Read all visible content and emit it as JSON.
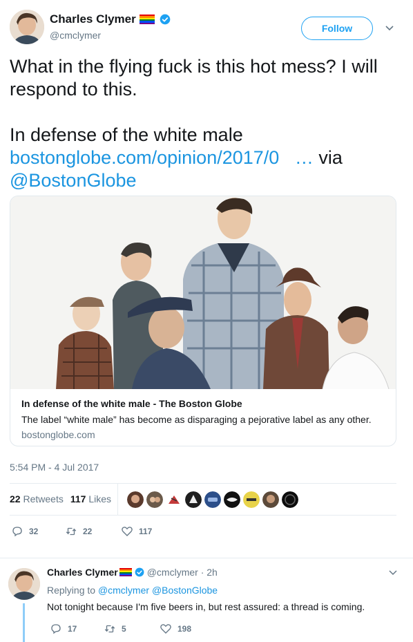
{
  "tweet": {
    "author_name": "Charles Clymer",
    "author_handle": "@cmclymer",
    "follow_label": "Follow",
    "text_line1": "What in the flying fuck is this hot mess? I will respond to this.",
    "text_line2": "In defense of the white male",
    "link_text": "bostonglobe.com/opinion/2017/0",
    "ellipsis": "…",
    "via_text": " via",
    "mention": "@BostonGlobe",
    "timestamp": "5:54 PM - 4 Jul 2017"
  },
  "card": {
    "title": "In defense of the white male - The Boston Globe",
    "description": "The label “white male” has become as disparaging a pejorative label as any other.",
    "domain": "bostonglobe.com"
  },
  "stats": {
    "retweets_count": "22",
    "retweets_label": "Retweets",
    "likes_count": "117",
    "likes_label": "Likes"
  },
  "actions": {
    "replies": "32",
    "retweets": "22",
    "likes": "117"
  },
  "reply": {
    "author_name": "Charles Clymer",
    "meta": "@cmclymer · 2h",
    "replying_prefix": "Replying to",
    "replying_to_1": "@cmclymer",
    "replying_to_2": "@BostonGlobe",
    "text": "Not tonight because I'm five beers in, but rest assured: a thread is coming.",
    "replies": "17",
    "retweets": "5",
    "likes": "198"
  },
  "colors": {
    "accent": "#1da1f2",
    "link": "#1b95e0",
    "muted": "#657786",
    "verified": "#1da1f2"
  }
}
